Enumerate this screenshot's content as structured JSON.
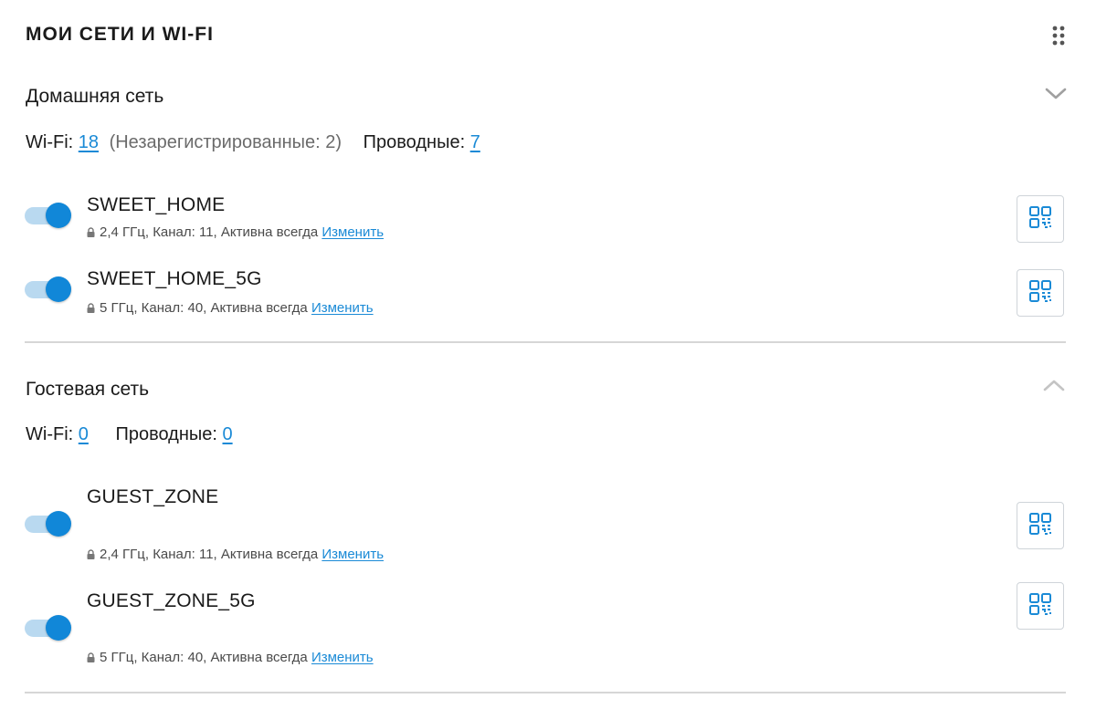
{
  "header": {
    "title": "МОИ СЕТИ И WI-FI",
    "menu_icon": "drag-handle-icon"
  },
  "home": {
    "title": "Домашняя сеть",
    "chevron": "chevron-down-icon",
    "wifi_label": "Wi-Fi:",
    "wifi_count": "18",
    "unregistered": "(Незарегистрированные: 2)",
    "wired_label": "Проводные:",
    "wired_count": "7",
    "networks": [
      {
        "ssid": "SWEET_HOME",
        "details": "2,4 ГГц,  Канал: 11, Активна всегда",
        "edit": "Изменить",
        "enabled": true
      },
      {
        "ssid": "SWEET_HOME_5G",
        "details": "5 ГГц,  Канал: 40, Активна всегда",
        "edit": "Изменить",
        "enabled": true
      }
    ]
  },
  "guest": {
    "title": "Гостевая сеть",
    "chevron": "chevron-up-icon",
    "wifi_label": "Wi-Fi:",
    "wifi_count": "0",
    "wired_label": "Проводные:",
    "wired_count": "0",
    "networks": [
      {
        "ssid": "GUEST_ZONE",
        "details": "2,4 ГГц,  Канал: 11, Активна всегда",
        "edit": "Изменить",
        "enabled": true
      },
      {
        "ssid": "GUEST_ZONE_5G",
        "details": "5 ГГц,  Канал: 40, Активна всегда",
        "edit": "Изменить",
        "enabled": true
      }
    ]
  },
  "colors": {
    "accent": "#1187d8",
    "link": "#1a8ad6",
    "track": "#b9d9f0",
    "divider": "#d6d6d6"
  }
}
